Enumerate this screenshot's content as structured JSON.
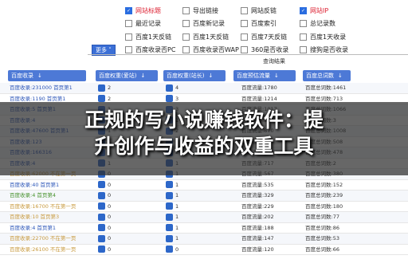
{
  "options": [
    {
      "label": "网站标题",
      "checked": true,
      "red": true
    },
    {
      "label": "导出链接",
      "checked": false
    },
    {
      "label": "网站反链",
      "checked": false
    },
    {
      "label": "网站IP",
      "checked": true,
      "red": true
    },
    {
      "label": "最近记录",
      "checked": false
    },
    {
      "label": "百度新记录",
      "checked": false
    },
    {
      "label": "百度索引",
      "checked": false
    },
    {
      "label": "总记录数",
      "checked": false
    },
    {
      "label": "百度1天反链",
      "checked": false
    },
    {
      "label": "百度1天反链",
      "checked": false
    },
    {
      "label": "百度7天反链",
      "checked": false
    },
    {
      "label": "百度1天收录",
      "checked": false
    },
    {
      "label": "百度收录否PC",
      "checked": false
    },
    {
      "label": "百度收录否WAP",
      "checked": false
    },
    {
      "label": "360是否收录",
      "checked": false
    },
    {
      "label": "搜狗是否收录",
      "checked": false
    }
  ],
  "more_button": "更多 ˅",
  "results_label": "查询结果",
  "columns": [
    {
      "label": "百度收录",
      "arrow": "↓"
    },
    {
      "label": "百度权重(爱站)",
      "arrow": "↓"
    },
    {
      "label": "百度权重(站长)",
      "arrow": "↓"
    },
    {
      "label": "百度预估流量",
      "arrow": "↓"
    },
    {
      "label": "百度总词数",
      "arrow": "↓"
    }
  ],
  "rows": [
    {
      "index": "百度收录:231000 首页第1",
      "r1": "2",
      "r2": "4",
      "flow": "百度流量:1780",
      "words": "百度总词数:1461",
      "tone": "blue"
    },
    {
      "index": "百度收录:1190 首页第1",
      "r1": "2",
      "r2": "3",
      "flow": "百度流量:1214",
      "words": "百度总词数:713",
      "tone": "blue"
    },
    {
      "index": "百度收录:5 首页第1",
      "r1": "1",
      "r2": "3",
      "flow": "百度流量:1017",
      "words": "百度总词数:1066",
      "tone": "blue"
    },
    {
      "index": "百度收录:4",
      "r1": "1",
      "r2": "1",
      "flow": "百度流量:882",
      "words": "百度总词数:3",
      "tone": "blue"
    },
    {
      "index": "百度收录:47600 首页第1",
      "r1": "1",
      "r2": "2",
      "flow": "百度流量:870",
      "words": "百度总词数:1008",
      "tone": "blue"
    },
    {
      "index": "百度收录:123",
      "r1": "1",
      "r2": "2",
      "flow": "百度流量:784",
      "words": "百度总词数:508",
      "tone": "blue"
    },
    {
      "index": "百度收录:166316",
      "r1": "1",
      "r2": "2",
      "flow": "百度流量:756",
      "words": "百度总词数:478",
      "tone": "blue"
    },
    {
      "index": "百度收录:4",
      "r1": "1",
      "r2": "1",
      "flow": "百度流量:717",
      "words": "百度总词数:2",
      "tone": "blue"
    },
    {
      "index": "百度收录:62000 不在第一页",
      "r1": "0",
      "r2": "1",
      "flow": "百度流量:567",
      "words": "百度总词数:380",
      "tone": "tan"
    },
    {
      "index": "百度收录:40 首页第1",
      "r1": "0",
      "r2": "1",
      "flow": "百度流量:535",
      "words": "百度总词数:152",
      "tone": "blue"
    },
    {
      "index": "百度收录:4 首页第4",
      "r1": "0",
      "r2": "1",
      "flow": "百度流量:329",
      "words": "百度总词数:239",
      "tone": "green"
    },
    {
      "index": "百度收录:16700 不在第一页",
      "r1": "0",
      "r2": "1",
      "flow": "百度流量:229",
      "words": "百度总词数:180",
      "tone": "tan"
    },
    {
      "index": "百度收录:10 首页第3",
      "r1": "0",
      "r2": "1",
      "flow": "百度流量:202",
      "words": "百度总词数:77",
      "tone": "tan"
    },
    {
      "index": "百度收录:4 首页第1",
      "r1": "0",
      "r2": "1",
      "flow": "百度流量:188",
      "words": "百度总词数:86",
      "tone": "blue"
    },
    {
      "index": "百度收录:22700 不在第一页",
      "r1": "0",
      "r2": "1",
      "flow": "百度流量:147",
      "words": "百度总词数:53",
      "tone": "tan"
    },
    {
      "index": "百度收录:26100 不在第一页",
      "r1": "0",
      "r2": "0",
      "flow": "百度流量:120",
      "words": "百度总词数:66",
      "tone": "tan"
    }
  ],
  "banner": {
    "line1": "正规的写小说赚钱软件：提",
    "line2": "升创作与收益的双重工具"
  }
}
